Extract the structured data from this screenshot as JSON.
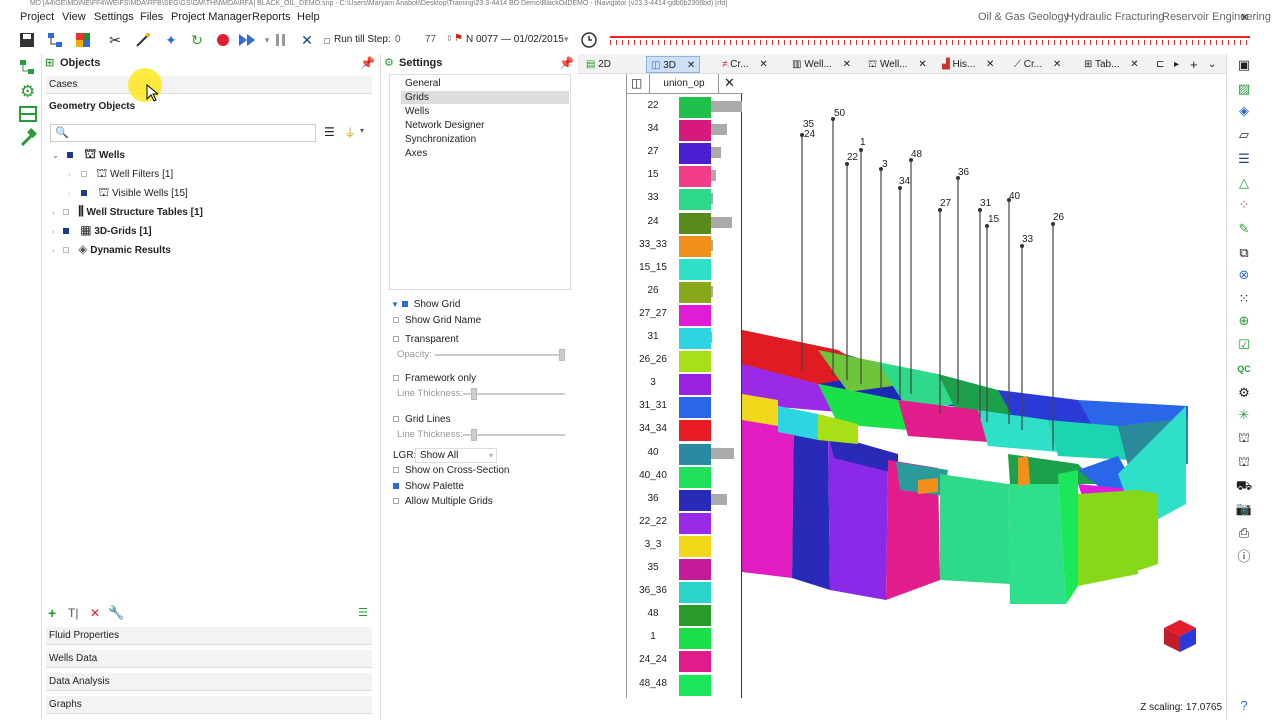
{
  "window": {
    "title": "MD [A4\\GE\\MD\\NE\\FF4\\WE\\FS\\MDA\\RFB\\SEG\\GS\\GM\\THN\\MDA\\RFA] BLACK_OIL_DEMO.snp - C:\\Users\\Maryam Anaboli\\Desktop\\Training\\23.3-4414 BO Demo\\BlackOilDEMO - tNavigator (v23.3-4414-gdb0b2306bd) [rfd]"
  },
  "menu": {
    "items": [
      "Project",
      "View",
      "Settings",
      "Files",
      "Project Manager",
      "Reports",
      "Help"
    ],
    "modules": [
      "Oil & Gas Geology",
      "Hydraulic Fracturing",
      "Reservoir Engineering"
    ]
  },
  "toolbar": {
    "run_till_step_label": "Run till Step:",
    "run_till_step_value": "0",
    "step_value": "77",
    "step_date": "N 0077 — 01/02/2015"
  },
  "objects_panel": {
    "title": "Objects",
    "cases_label": "Cases",
    "geometry_label": "Geometry Objects",
    "search_placeholder": "",
    "tree": {
      "wells": "Wells",
      "well_filters": "Well Filters [1]",
      "visible_wells": "Visible Wells [15]",
      "well_structure_tables": "Well Structure Tables [1]",
      "grids": "3D-Grids [1]",
      "dynamic_results": "Dynamic Results"
    },
    "bottom_sections": [
      "Fluid Properties",
      "Wells Data",
      "Data Analysis",
      "Graphs"
    ]
  },
  "settings_panel": {
    "title": "Settings",
    "categories": [
      "General",
      "Grids",
      "Wells",
      "Network Designer",
      "Synchronization",
      "Axes"
    ],
    "selected_category": "Grids",
    "options": {
      "show_grid": "Show Grid",
      "show_grid_name": "Show Grid Name",
      "transparent": "Transparent",
      "opacity": "Opacity:",
      "framework_only": "Framework only",
      "line_thickness_1": "Line Thickness:",
      "grid_lines": "Grid Lines",
      "line_thickness_2": "Line Thickness:",
      "lgr_label": "LGR:",
      "lgr_value": "Show All",
      "show_on_cross_section": "Show on Cross-Section",
      "show_palette": "Show Palette",
      "allow_multiple_grids": "Allow Multiple Grids"
    },
    "option_state": {
      "show_grid": true,
      "show_grid_name": false,
      "transparent": false,
      "framework_only": false,
      "grid_lines": false,
      "show_on_cross_section": false,
      "show_palette": true,
      "allow_multiple_grids": false
    }
  },
  "view_tabs": [
    {
      "label": "2D",
      "active": false
    },
    {
      "label": "3D",
      "active": true
    },
    {
      "label": "Cr...",
      "active": false
    },
    {
      "label": "Well...",
      "active": false
    },
    {
      "label": "Well...",
      "active": false
    },
    {
      "label": "His...",
      "active": false
    },
    {
      "label": "Cr...",
      "active": false
    },
    {
      "label": "Tab...",
      "active": false
    }
  ],
  "palette": {
    "title": "union_op",
    "entries": [
      {
        "label": "22",
        "color": "#1fc04b",
        "bar": 0.6
      },
      {
        "label": "34",
        "color": "#d6197a",
        "bar": 0.3
      },
      {
        "label": "27",
        "color": "#4a1fd1",
        "bar": 0.2
      },
      {
        "label": "15",
        "color": "#f23e88",
        "bar": 0.1
      },
      {
        "label": "33",
        "color": "#2fd98a",
        "bar": 0.04
      },
      {
        "label": "24",
        "color": "#5a8a1c",
        "bar": 0.4
      },
      {
        "label": "33_33",
        "color": "#f0901a",
        "bar": 0.03
      },
      {
        "label": "15_15",
        "color": "#2ee0c8",
        "bar": 0
      },
      {
        "label": "26",
        "color": "#88a81a",
        "bar": 0.04
      },
      {
        "label": "27_27",
        "color": "#e01cd8",
        "bar": 0
      },
      {
        "label": "31",
        "color": "#2ed4e0",
        "bar": 0.01
      },
      {
        "label": "26_26",
        "color": "#a8e018",
        "bar": 0
      },
      {
        "label": "3",
        "color": "#9a22e0",
        "bar": 0
      },
      {
        "label": "31_31",
        "color": "#2a66e8",
        "bar": 0
      },
      {
        "label": "34_34",
        "color": "#e81c22",
        "bar": 0
      },
      {
        "label": "40",
        "color": "#2a8aa0",
        "bar": 0.45
      },
      {
        "label": "40_40",
        "color": "#1fe05a",
        "bar": 0
      },
      {
        "label": "36",
        "color": "#2a2ab8",
        "bar": 0.3
      },
      {
        "label": "22_22",
        "color": "#9a2ae8",
        "bar": 0
      },
      {
        "label": "3_3",
        "color": "#f0d81a",
        "bar": 0
      },
      {
        "label": "35",
        "color": "#c41c9a",
        "bar": 0
      },
      {
        "label": "36_36",
        "color": "#2ad4c8",
        "bar": 0
      },
      {
        "label": "48",
        "color": "#2a9a2a",
        "bar": 0
      },
      {
        "label": "1",
        "color": "#1ae048",
        "bar": 0
      },
      {
        "label": "24_24",
        "color": "#e01c8a",
        "bar": 0
      },
      {
        "label": "48_48",
        "color": "#1ae85a",
        "bar": 0
      }
    ]
  },
  "wells": [
    "35",
    "24",
    "50",
    "22",
    "1",
    "3",
    "34",
    "48",
    "27",
    "36",
    "31",
    "15",
    "40",
    "33",
    "26"
  ],
  "status": {
    "z_scaling": "Z scaling: 17.0765"
  }
}
